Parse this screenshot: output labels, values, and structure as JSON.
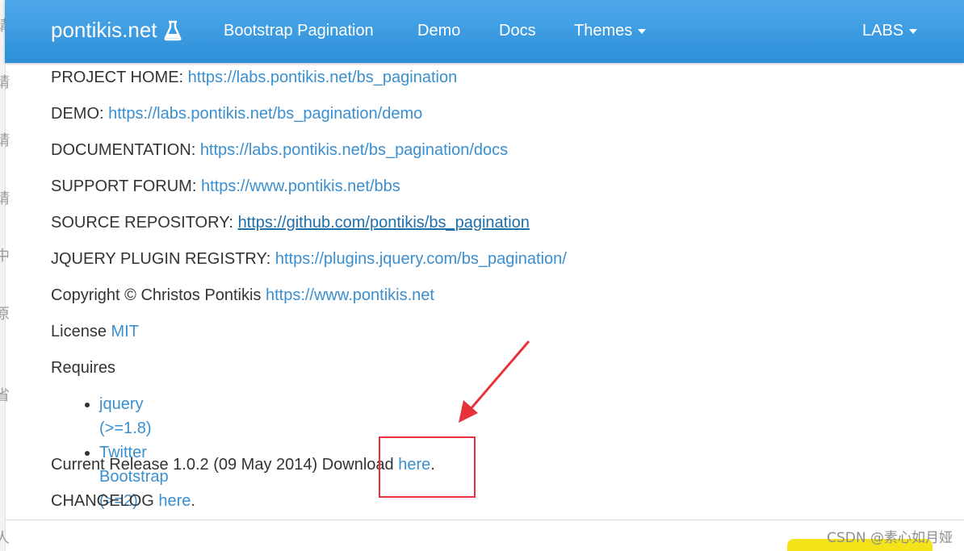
{
  "navbar": {
    "brand": "pontikis.net",
    "brand_icon": "flask-icon",
    "items": [
      {
        "label": "Bootstrap Pagination"
      },
      {
        "label": "Demo"
      },
      {
        "label": "Docs"
      },
      {
        "label": "Themes"
      }
    ],
    "right_item": "LABS",
    "background_color": "#3a9ee3"
  },
  "content": {
    "project_home": {
      "label": "PROJECT HOME:",
      "url": "https://labs.pontikis.net/bs_pagination"
    },
    "demo": {
      "label": "DEMO:",
      "url": "https://labs.pontikis.net/bs_pagination/demo"
    },
    "documentation": {
      "label": "DOCUMENTATION:",
      "url": "https://labs.pontikis.net/bs_pagination/docs"
    },
    "support_forum": {
      "label": "SUPPORT FORUM:",
      "url": "https://www.pontikis.net/bbs"
    },
    "source_repository": {
      "label": "SOURCE REPOSITORY:",
      "url": "https://github.com/pontikis/bs_pagination"
    },
    "jquery_registry": {
      "label": "JQUERY PLUGIN REGISTRY:",
      "url": "https://plugins.jquery.com/bs_pagination/"
    },
    "copyright": {
      "label": "Copyright © Christos Pontikis",
      "url": "https://www.pontikis.net"
    },
    "license": {
      "label": "License",
      "link": "MIT"
    },
    "requires": {
      "label": "Requires",
      "items": [
        "jquery (>=1.8)",
        "Twitter Bootstrap (>=2)"
      ]
    },
    "current_release": {
      "label": "Current Release 1.0.2 (09 May 2014) Download",
      "link": "here",
      "suffix": "."
    },
    "changelog": {
      "label": "CHANGELOG",
      "link": "here",
      "suffix": "."
    }
  },
  "colors": {
    "link": "#3a8fd0",
    "annotation": "#e8323a"
  },
  "watermark": "CSDN @素心如月娅"
}
